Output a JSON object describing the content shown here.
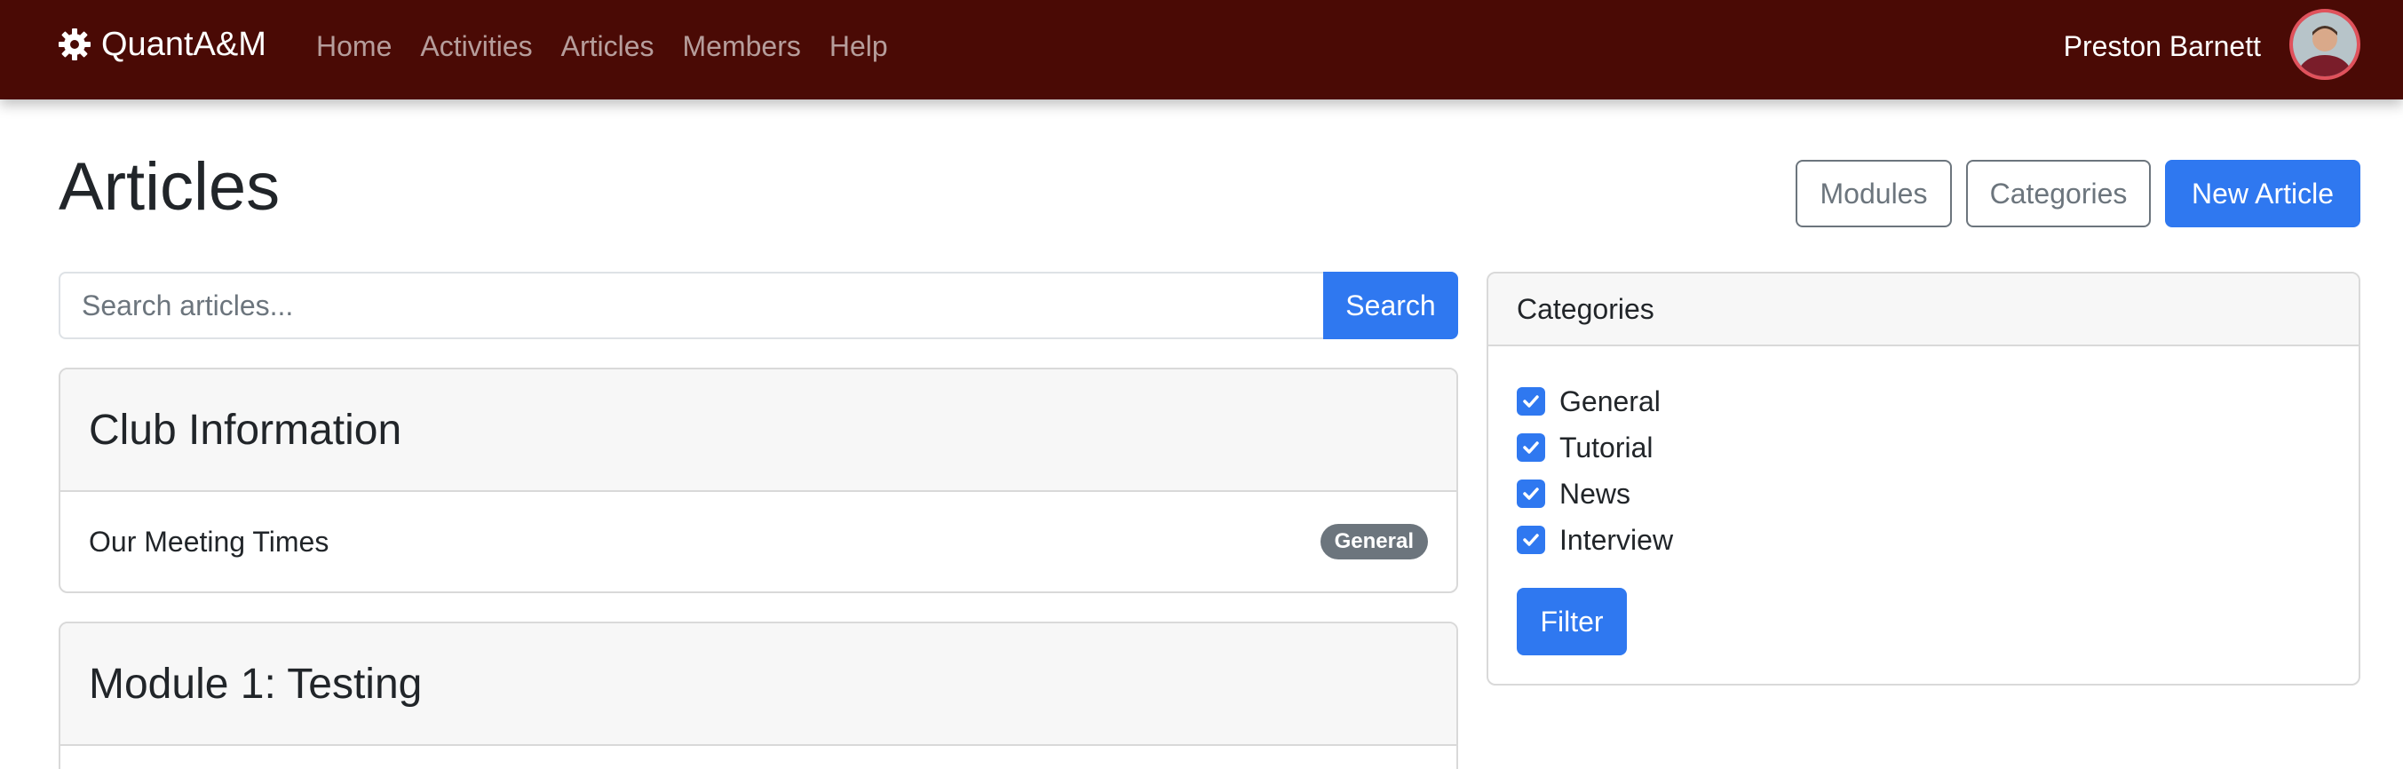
{
  "navbar": {
    "brand": "QuantA&M",
    "links": [
      "Home",
      "Activities",
      "Articles",
      "Members",
      "Help"
    ],
    "user_name": "Preston Barnett"
  },
  "page": {
    "title": "Articles",
    "buttons": {
      "modules": "Modules",
      "categories": "Categories",
      "new_article": "New Article"
    }
  },
  "search": {
    "placeholder": "Search articles...",
    "button": "Search"
  },
  "sections": [
    {
      "title": "Club Information",
      "articles": [
        {
          "title": "Our Meeting Times",
          "badge": "General"
        }
      ]
    },
    {
      "title": "Module 1: Testing",
      "articles": []
    }
  ],
  "categories_panel": {
    "header": "Categories",
    "items": [
      {
        "label": "General",
        "checked": true
      },
      {
        "label": "Tutorial",
        "checked": true
      },
      {
        "label": "News",
        "checked": true
      },
      {
        "label": "Interview",
        "checked": true
      }
    ],
    "filter_button": "Filter"
  },
  "colors": {
    "navbar": "#4a0a05",
    "primary": "#2f78f0",
    "secondary": "#6c757d"
  }
}
